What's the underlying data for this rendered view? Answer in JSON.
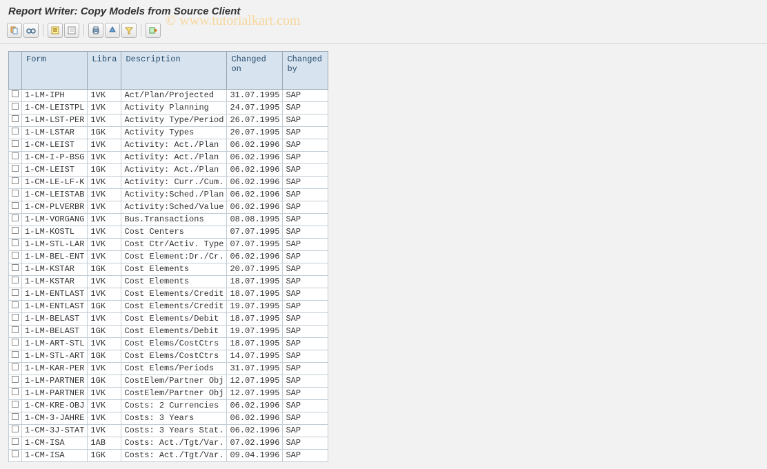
{
  "title": "Report Writer: Copy Models from Source Client",
  "watermark": "© www.tutorialkart.com",
  "toolbar_icons": [
    "copy-object-icon",
    "glasses-icon",
    "select-all-icon",
    "deselect-all-icon",
    "print-icon",
    "sort-asc-icon",
    "filter-icon",
    "export-icon"
  ],
  "columns": {
    "form": "Form",
    "libra": "Libra",
    "description": "Description",
    "changed_on": "Changed on",
    "changed_by": "Changed by"
  },
  "rows": [
    {
      "form": "1-LM-IPH",
      "lib": "1VK",
      "desc": "Act/Plan/Projected",
      "chon": "31.07.1995",
      "chby": "SAP"
    },
    {
      "form": "1-CM-LEISTPL",
      "lib": "1VK",
      "desc": "Activity Planning",
      "chon": "24.07.1995",
      "chby": "SAP"
    },
    {
      "form": "1-LM-LST-PER",
      "lib": "1VK",
      "desc": "Activity Type/Period",
      "chon": "26.07.1995",
      "chby": "SAP"
    },
    {
      "form": "1-LM-LSTAR",
      "lib": "1GK",
      "desc": "Activity Types",
      "chon": "20.07.1995",
      "chby": "SAP"
    },
    {
      "form": "1-CM-LEIST",
      "lib": "1VK",
      "desc": "Activity: Act./Plan",
      "chon": "06.02.1996",
      "chby": "SAP"
    },
    {
      "form": "1-CM-I-P-BSG",
      "lib": "1VK",
      "desc": "Activity: Act./Plan",
      "chon": "06.02.1996",
      "chby": "SAP"
    },
    {
      "form": "1-CM-LEIST",
      "lib": "1GK",
      "desc": "Activity: Act./Plan",
      "chon": "06.02.1996",
      "chby": "SAP"
    },
    {
      "form": "1-CM-LE-LF-K",
      "lib": "1VK",
      "desc": "Activity: Curr./Cum.",
      "chon": "06.02.1996",
      "chby": "SAP"
    },
    {
      "form": "1-CM-LEISTAB",
      "lib": "1VK",
      "desc": "Activity:Sched./Plan",
      "chon": "06.02.1996",
      "chby": "SAP"
    },
    {
      "form": "1-CM-PLVERBR",
      "lib": "1VK",
      "desc": "Activity:Sched/Value",
      "chon": "06.02.1996",
      "chby": "SAP"
    },
    {
      "form": "1-LM-VORGANG",
      "lib": "1VK",
      "desc": "Bus.Transactions",
      "chon": "08.08.1995",
      "chby": "SAP"
    },
    {
      "form": "1-LM-KOSTL",
      "lib": "1VK",
      "desc": "Cost Centers",
      "chon": "07.07.1995",
      "chby": "SAP"
    },
    {
      "form": "1-LM-STL-LAR",
      "lib": "1VK",
      "desc": "Cost Ctr/Activ. Type",
      "chon": "07.07.1995",
      "chby": "SAP"
    },
    {
      "form": "1-LM-BEL-ENT",
      "lib": "1VK",
      "desc": "Cost Element:Dr./Cr.",
      "chon": "06.02.1996",
      "chby": "SAP"
    },
    {
      "form": "1-LM-KSTAR",
      "lib": "1GK",
      "desc": "Cost Elements",
      "chon": "20.07.1995",
      "chby": "SAP"
    },
    {
      "form": "1-LM-KSTAR",
      "lib": "1VK",
      "desc": "Cost Elements",
      "chon": "18.07.1995",
      "chby": "SAP"
    },
    {
      "form": "1-LM-ENTLAST",
      "lib": "1VK",
      "desc": "Cost Elements/Credit",
      "chon": "18.07.1995",
      "chby": "SAP"
    },
    {
      "form": "1-LM-ENTLAST",
      "lib": "1GK",
      "desc": "Cost Elements/Credit",
      "chon": "19.07.1995",
      "chby": "SAP"
    },
    {
      "form": "1-LM-BELAST",
      "lib": "1VK",
      "desc": "Cost Elements/Debit",
      "chon": "18.07.1995",
      "chby": "SAP"
    },
    {
      "form": "1-LM-BELAST",
      "lib": "1GK",
      "desc": "Cost Elements/Debit",
      "chon": "19.07.1995",
      "chby": "SAP"
    },
    {
      "form": "1-LM-ART-STL",
      "lib": "1VK",
      "desc": "Cost Elems/CostCtrs",
      "chon": "18.07.1995",
      "chby": "SAP"
    },
    {
      "form": "1-LM-STL-ART",
      "lib": "1GK",
      "desc": "Cost Elems/CostCtrs",
      "chon": "14.07.1995",
      "chby": "SAP"
    },
    {
      "form": "1-LM-KAR-PER",
      "lib": "1VK",
      "desc": "Cost Elems/Periods",
      "chon": "31.07.1995",
      "chby": "SAP"
    },
    {
      "form": "1-LM-PARTNER",
      "lib": "1GK",
      "desc": "CostElem/Partner Obj",
      "chon": "12.07.1995",
      "chby": "SAP"
    },
    {
      "form": "1-LM-PARTNER",
      "lib": "1VK",
      "desc": "CostElem/Partner Obj",
      "chon": "12.07.1995",
      "chby": "SAP"
    },
    {
      "form": "1-CM-KRE-OBJ",
      "lib": "1VK",
      "desc": "Costs: 2 Currencies",
      "chon": "06.02.1996",
      "chby": "SAP"
    },
    {
      "form": "1-CM-3-JAHRE",
      "lib": "1VK",
      "desc": "Costs: 3 Years",
      "chon": "06.02.1996",
      "chby": "SAP"
    },
    {
      "form": "1-CM-3J-STAT",
      "lib": "1VK",
      "desc": "Costs: 3 Years Stat.",
      "chon": "06.02.1996",
      "chby": "SAP"
    },
    {
      "form": "1-CM-ISA",
      "lib": "1AB",
      "desc": "Costs: Act./Tgt/Var.",
      "chon": "07.02.1996",
      "chby": "SAP"
    },
    {
      "form": "1-CM-ISA",
      "lib": "1GK",
      "desc": "Costs: Act./Tgt/Var.",
      "chon": "09.04.1996",
      "chby": "SAP"
    }
  ]
}
